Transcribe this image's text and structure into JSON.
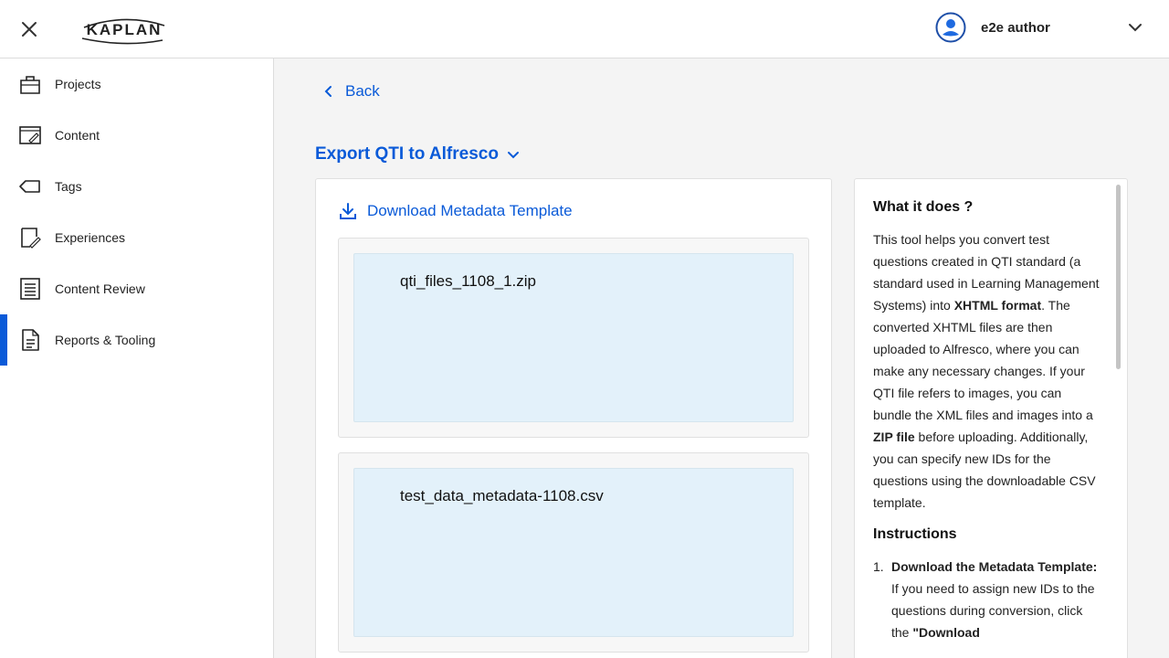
{
  "header": {
    "logo_text": "KAPLAN",
    "user_name": "e2e author"
  },
  "sidebar": {
    "items": [
      {
        "label": "Projects",
        "icon": "projects-icon"
      },
      {
        "label": "Content",
        "icon": "content-icon"
      },
      {
        "label": "Tags",
        "icon": "tag-icon"
      },
      {
        "label": "Experiences",
        "icon": "experiences-icon"
      },
      {
        "label": "Content Review",
        "icon": "content-review-icon"
      },
      {
        "label": "Reports & Tooling",
        "icon": "reports-icon",
        "active": true
      }
    ]
  },
  "main": {
    "back_label": "Back",
    "title": "Export QTI to Alfresco",
    "download_label": "Download Metadata Template",
    "uploads": [
      {
        "file_name": "qti_files_1108_1.zip"
      },
      {
        "file_name": "test_data_metadata-1108.csv"
      }
    ]
  },
  "info": {
    "heading": "What it does ?",
    "desc_1": "This tool helps you convert test questions created in QTI standard (a standard used in Learning Management Systems) into ",
    "desc_bold_1": "XHTML format",
    "desc_2": ". The converted XHTML files are then uploaded to Alfresco, where you can make any necessary changes. If your QTI file refers to images, you can bundle the XML files and images into a ",
    "desc_bold_2": "ZIP file",
    "desc_3": " before uploading. Additionally, you can specify new IDs for the questions using the downloadable CSV template.",
    "instructions_heading": "Instructions",
    "step1_num": "1.",
    "step1_title": "Download the Metadata Template:",
    "step1_text": "If you need to assign new IDs to the questions during conversion, click the ",
    "step1_bold": "\"Download"
  },
  "colors": {
    "accent": "#0a5ad8",
    "upload_bg": "#e3f1fa",
    "main_bg": "#f4f4f4"
  }
}
